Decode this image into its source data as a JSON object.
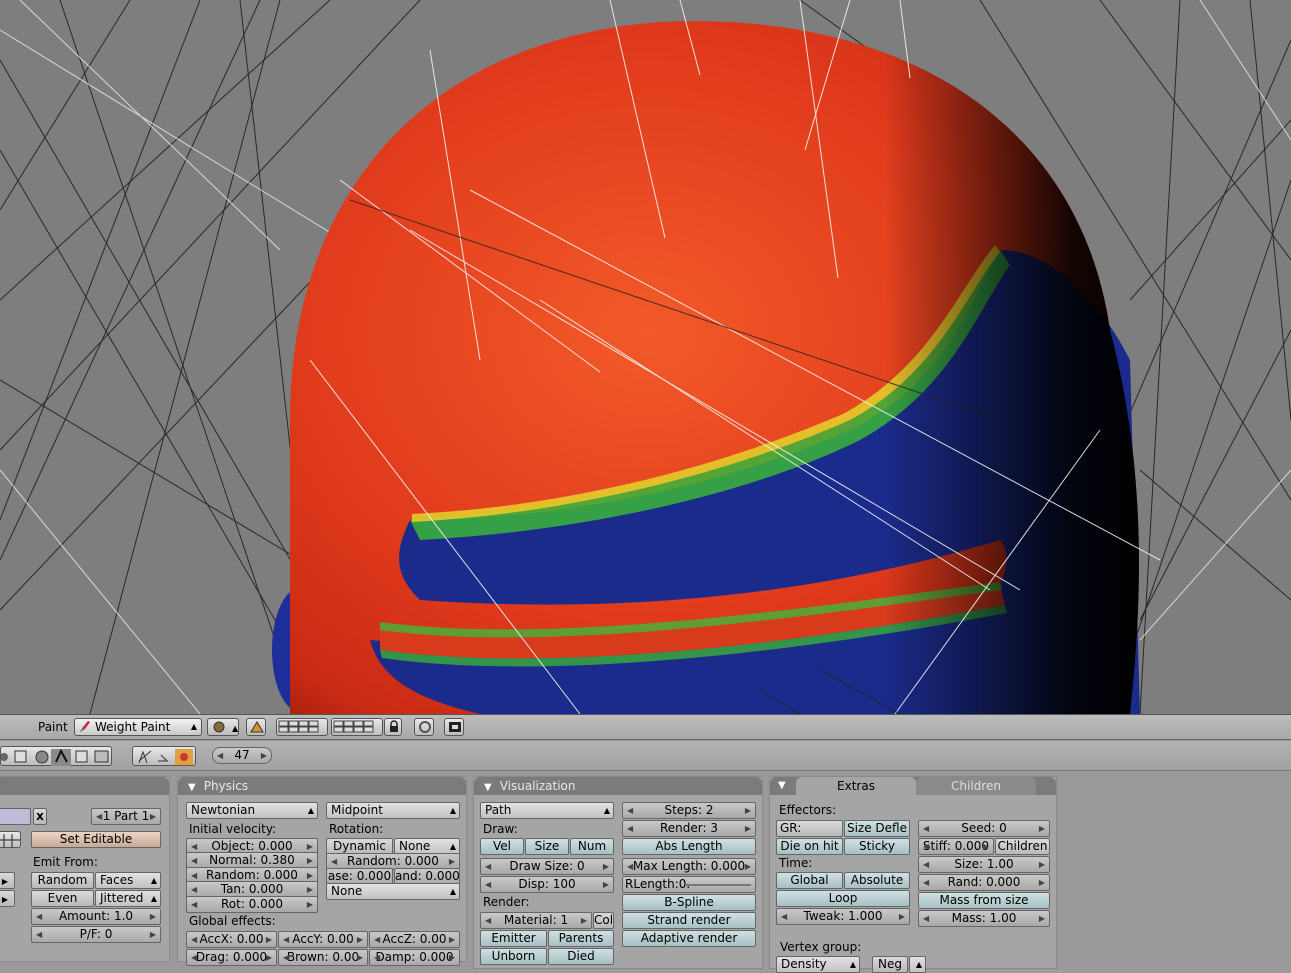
{
  "viewport_header": {
    "mode_label": "Paint",
    "mode_value": "Weight Paint"
  },
  "buttons_header": {
    "frame": "47"
  },
  "left_panel": {
    "part_value": "1 Part 1",
    "close": "x",
    "set_editable": "Set Editable",
    "emit_from": "Emit From:",
    "random": "Random",
    "faces": "Faces",
    "even": "Even",
    "jittered": "Jittered",
    "amount": "Amount: 1.0",
    "pf": "P/F: 0"
  },
  "physics": {
    "title": "Physics",
    "type": "Newtonian",
    "integrator": "Midpoint",
    "initial_velocity": "Initial velocity:",
    "object": "Object: 0.000",
    "normal": "Normal: 0.380",
    "random": "Random: 0.000",
    "tan": "Tan: 0.000",
    "rot": "Rot: 0.000",
    "rotation": "Rotation:",
    "dynamic": "Dynamic",
    "none1": "None",
    "rot_random": "Random: 0.000",
    "phase": "ase: 0.000",
    "and": "and: 0.000",
    "none2": "None",
    "global_effects": "Global effects:",
    "accx": "AccX: 0.00",
    "accy": "AccY: 0.00",
    "accz": "AccZ: 0.00",
    "drag": "Drag: 0.000",
    "brown": "Brown: 0.00",
    "damp": "Damp: 0.000"
  },
  "visualization": {
    "title": "Visualization",
    "mode": "Path",
    "draw": "Draw:",
    "vel": "Vel",
    "size": "Size",
    "num": "Num",
    "draw_size": "Draw Size: 0",
    "disp": "Disp: 100",
    "render": "Render:",
    "material": "Material: 1",
    "col": "Col",
    "emitter": "Emitter",
    "parents": "Parents",
    "unborn": "Unborn",
    "died": "Died",
    "steps": "Steps: 2",
    "render_steps": "Render: 3",
    "abs_length": "Abs Length",
    "max_length": "Max Length: 0.000",
    "rlength": "RLength:0.",
    "bspline": "B-Spline",
    "strand_render": "Strand render",
    "adaptive_render": "Adaptive render"
  },
  "extras": {
    "tab_extras": "Extras",
    "tab_children": "Children",
    "effectors": "Effectors:",
    "gr": "GR:",
    "size_defl": "Size Defle",
    "die_on_hit": "Die on hit",
    "sticky": "Sticky",
    "time": "Time:",
    "global": "Global",
    "absolute": "Absolute",
    "loop": "Loop",
    "tweak": "Tweak: 1.000",
    "seed": "Seed: 0",
    "stiff": "Stiff: 0.000",
    "children": "Children",
    "size": "Size: 1.00",
    "rand": "Rand: 0.000",
    "mass_from_size": "Mass from size",
    "mass": "Mass: 1.00",
    "vertex_group": "Vertex group:",
    "density": "Density",
    "neg": "Neg"
  }
}
